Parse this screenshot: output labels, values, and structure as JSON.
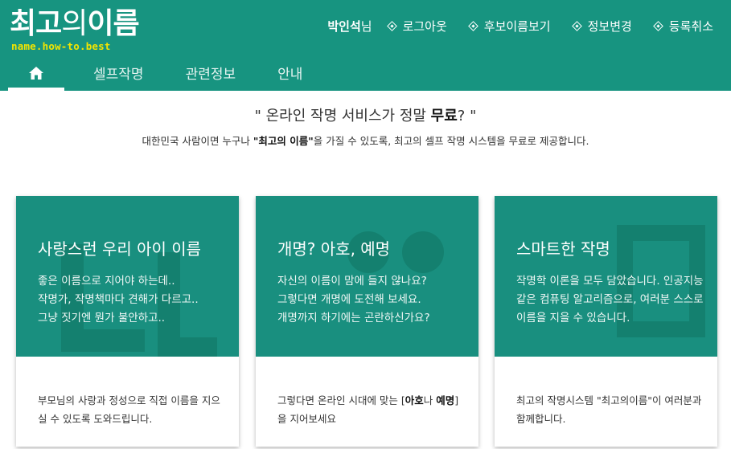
{
  "brand": {
    "title_bold_1": "최고",
    "title_light": "의",
    "title_bold_2": "이름",
    "subtitle": "name.how-to.best"
  },
  "user": {
    "name": "박인석",
    "suffix": "님"
  },
  "top_links": [
    {
      "label": "로그아웃"
    },
    {
      "label": "후보이름보기"
    },
    {
      "label": "정보변경"
    },
    {
      "label": "등록취소"
    }
  ],
  "nav": {
    "home_icon": "home-icon",
    "items": [
      {
        "label": "셀프작명"
      },
      {
        "label": "관련정보"
      },
      {
        "label": "안내"
      }
    ]
  },
  "intro": {
    "title_pre": "\" 온라인 작명 서비스가 정말 ",
    "title_bold": "무료",
    "title_post": "? \"",
    "desc_pre": "대한민국 사람이면 누구나 ",
    "desc_bold": "\"최고의 이름\"",
    "desc_post": "을 가질 수 있도록, 최고의 셀프 작명 시스템을 무료로 제공합니다."
  },
  "cards": [
    {
      "title": "사랑스런 우리 아이 이름",
      "lines": [
        "좋은 이름으로 지어야 하는데..",
        "작명가, 작명책마다 견해가 다르고..",
        "그냥 짓기엔 뭔가 불안하고.."
      ],
      "bottom_pre": "부모님의 사랑과 정성으로 직접 이름을 지으실 수 있도록 도와드립니다.",
      "bottom_b1": "",
      "bottom_mid": "",
      "bottom_b2": "",
      "bottom_post": ""
    },
    {
      "title": "개명? 아호, 예명",
      "lines": [
        "자신의 이름이 맘에 들지 않나요?",
        "그렇다면 개명에 도전해 보세요.",
        "개명까지 하기에는 곤란하신가요?"
      ],
      "bottom_pre": "그렇다면 온라인 시대에 맞는 [",
      "bottom_b1": "아호",
      "bottom_mid": "나 ",
      "bottom_b2": "예명",
      "bottom_post": "]을 지어보세요"
    },
    {
      "title": "스마트한 작명",
      "lines": [
        "작명학 이론을 모두 담았습니다. 인공지능 같은 컴퓨팅 알고리즘으로, 여러분 스스로 이름을 지을 수 있습니다."
      ],
      "bottom_pre": "최고의 작명시스템 \"최고의이름\"이 여러분과 함께합니다.",
      "bottom_b1": "",
      "bottom_mid": "",
      "bottom_b2": "",
      "bottom_post": ""
    }
  ],
  "colors": {
    "header_green": "#179480",
    "card_green": "#198f7f",
    "logo_yellow": "#f2e500"
  }
}
